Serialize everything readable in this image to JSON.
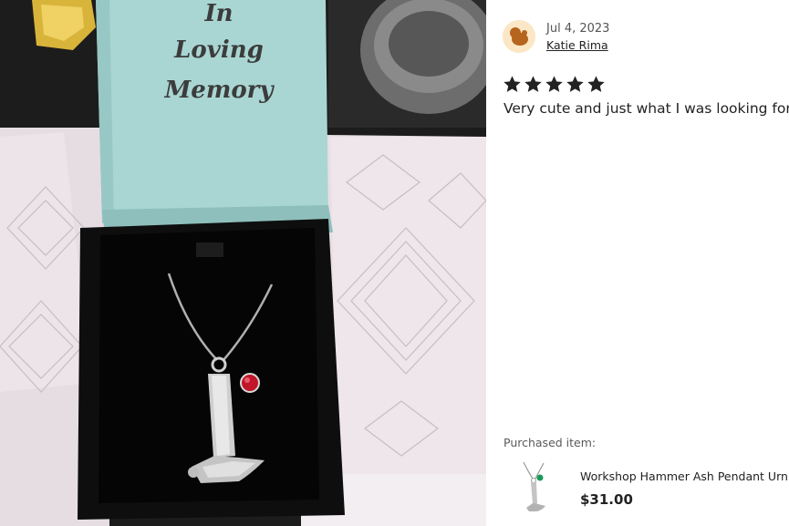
{
  "photo": {
    "lid_text": [
      "In",
      "Loving",
      "Memory"
    ]
  },
  "review": {
    "date": "Jul 4, 2023",
    "author": "Katie Rima",
    "rating": 5,
    "text": "Very cute and just what I was looking for.",
    "colors": {
      "star": "#222222",
      "avatar_bg": "#fbe7c6",
      "avatar_fg": "#b5651d"
    }
  },
  "purchased": {
    "label": "Purchased item:",
    "product_name": "Workshop Hammer Ash Pendant Urn",
    "price": "$31.00"
  }
}
